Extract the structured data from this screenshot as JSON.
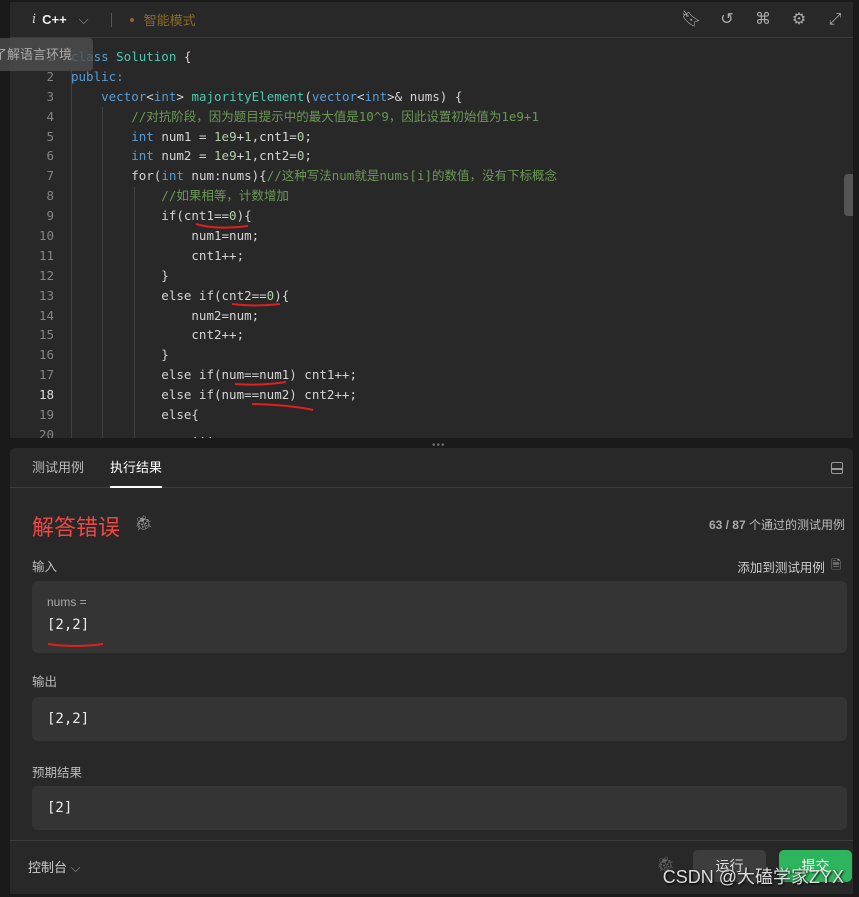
{
  "editor": {
    "language": "C++",
    "language_icon": "i",
    "mode": "智能模式",
    "tooltip": "了解语言环境",
    "tools": [
      "bookmark-icon",
      "reset-icon",
      "command-icon",
      "settings-icon",
      "expand-icon"
    ],
    "current_line": 18,
    "lines": [
      [
        [
          "class ",
          "ty"
        ],
        [
          "Solution",
          "cl"
        ],
        [
          " {",
          "kw"
        ]
      ],
      [
        [
          "public:",
          "ty"
        ]
      ],
      [
        [
          "    vector",
          "ty"
        ],
        [
          "<",
          "kw"
        ],
        [
          "int",
          "ty"
        ],
        [
          "> ",
          "kw"
        ],
        [
          "majorityElement",
          "fn"
        ],
        [
          "(",
          "kw"
        ],
        [
          "vector",
          "ty"
        ],
        [
          "<",
          "kw"
        ],
        [
          "int",
          "ty"
        ],
        [
          ">& nums) {",
          "kw"
        ]
      ],
      [
        [
          "        //对抗阶段，因为题目提示中的最大值是10^9，因此设置初始值为1e9+1",
          "cm"
        ]
      ],
      [
        [
          "        ",
          "kw"
        ],
        [
          "int",
          "ty"
        ],
        [
          " num1 = ",
          "kw"
        ],
        [
          "1e9",
          "nu"
        ],
        [
          "+",
          "kw"
        ],
        [
          "1",
          "nu"
        ],
        [
          ",cnt1=",
          "kw"
        ],
        [
          "0",
          "nu"
        ],
        [
          ";",
          "kw"
        ]
      ],
      [
        [
          "        ",
          "kw"
        ],
        [
          "int",
          "ty"
        ],
        [
          " num2 = ",
          "kw"
        ],
        [
          "1e9",
          "nu"
        ],
        [
          "+",
          "kw"
        ],
        [
          "1",
          "nu"
        ],
        [
          ",cnt2=",
          "kw"
        ],
        [
          "0",
          "nu"
        ],
        [
          ";",
          "kw"
        ]
      ],
      [
        [
          "        for(",
          "kw"
        ],
        [
          "int",
          "ty"
        ],
        [
          " num:nums){",
          "kw"
        ],
        [
          "//这种写法num就是nums[i]的数值，没有下标概念",
          "cm"
        ]
      ],
      [
        [
          "            //如果相等，计数增加",
          "cm"
        ]
      ],
      [
        [
          "            if(cnt1==",
          "kw"
        ],
        [
          "0",
          "nu"
        ],
        [
          "){",
          "kw"
        ]
      ],
      [
        [
          "                num1=num;",
          "kw"
        ]
      ],
      [
        [
          "                cnt1++;",
          "kw"
        ]
      ],
      [
        [
          "            }",
          "kw"
        ]
      ],
      [
        [
          "            else if(cnt2==",
          "kw"
        ],
        [
          "0",
          "nu"
        ],
        [
          "){",
          "kw"
        ]
      ],
      [
        [
          "                num2=num;",
          "kw"
        ]
      ],
      [
        [
          "                cnt2++;",
          "kw"
        ]
      ],
      [
        [
          "            }",
          "kw"
        ]
      ],
      [
        [
          "            else if(num==num1) cnt1++;",
          "kw"
        ]
      ],
      [
        [
          "            else if(num==num2) cnt2++;",
          "kw"
        ]
      ],
      [
        [
          "            else{",
          "kw"
        ]
      ],
      [
        [
          "                ...",
          "kw"
        ]
      ]
    ]
  },
  "result": {
    "tabs": [
      "测试用例",
      "执行结果"
    ],
    "active_tab": "执行结果",
    "verdict": "解答错误",
    "verdict_color": "#ef4743",
    "passed": "63 / 87",
    "passed_suffix": "个通过的测试用例",
    "input_label": "输入",
    "add_case": "添加到测试用例",
    "input_var": "nums =",
    "input_value": "[2,2]",
    "output_label": "输出",
    "output_value": "[2,2]",
    "expected_label": "预期结果",
    "expected_value": "[2]"
  },
  "footer": {
    "console": "控制台",
    "run": "运行",
    "submit": "提交",
    "submit_color": "#2db55d"
  },
  "watermark": "CSDN @大磕学家ZYX"
}
